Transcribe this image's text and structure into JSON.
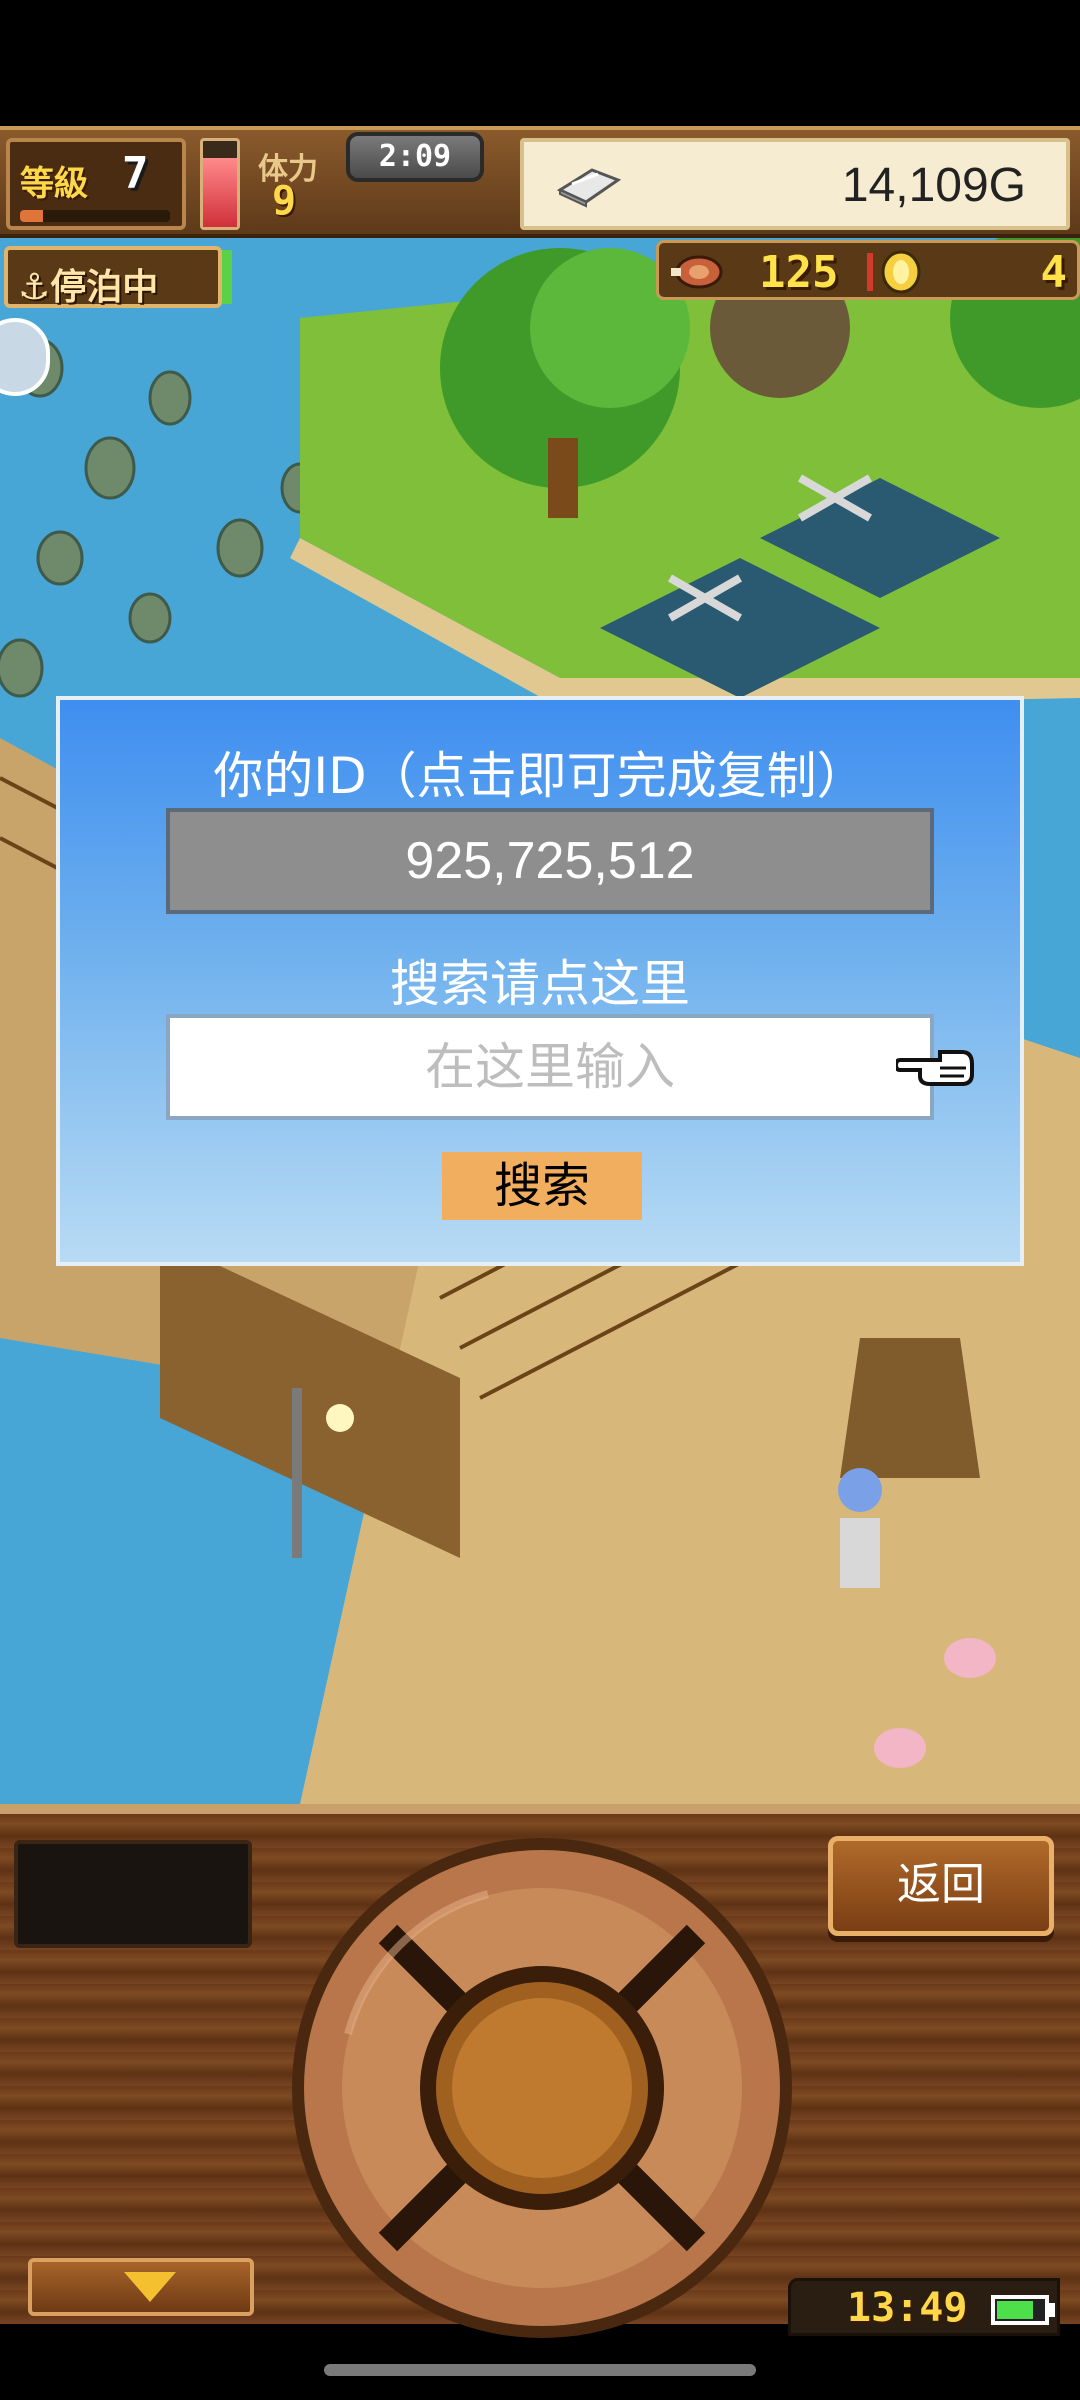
{
  "hud": {
    "level_label": "等級",
    "level_value": "7",
    "xp_fraction": 0.15,
    "stamina_fraction": 0.8,
    "stamina_label": "体力",
    "stamina_value": "9",
    "timer": "2:09",
    "gold": "14,109G"
  },
  "status": {
    "anchor_label": "⚓停泊中",
    "food_count": "125",
    "coin_count": "4"
  },
  "dialog": {
    "title": "你的ID（点击即可完成复制）",
    "player_id": "925,725,512",
    "search_label": "搜索请点这里",
    "search_placeholder": "在这里输入",
    "search_button": "搜索"
  },
  "panel": {
    "back_button": "返回",
    "clock": "13:49",
    "battery_fraction": 0.8
  },
  "colors": {
    "dialog_top": "#3f8ef0",
    "dialog_bottom": "#b8dbf4",
    "search_button": "#f0ae5e",
    "id_box": "#8e8e8e"
  }
}
